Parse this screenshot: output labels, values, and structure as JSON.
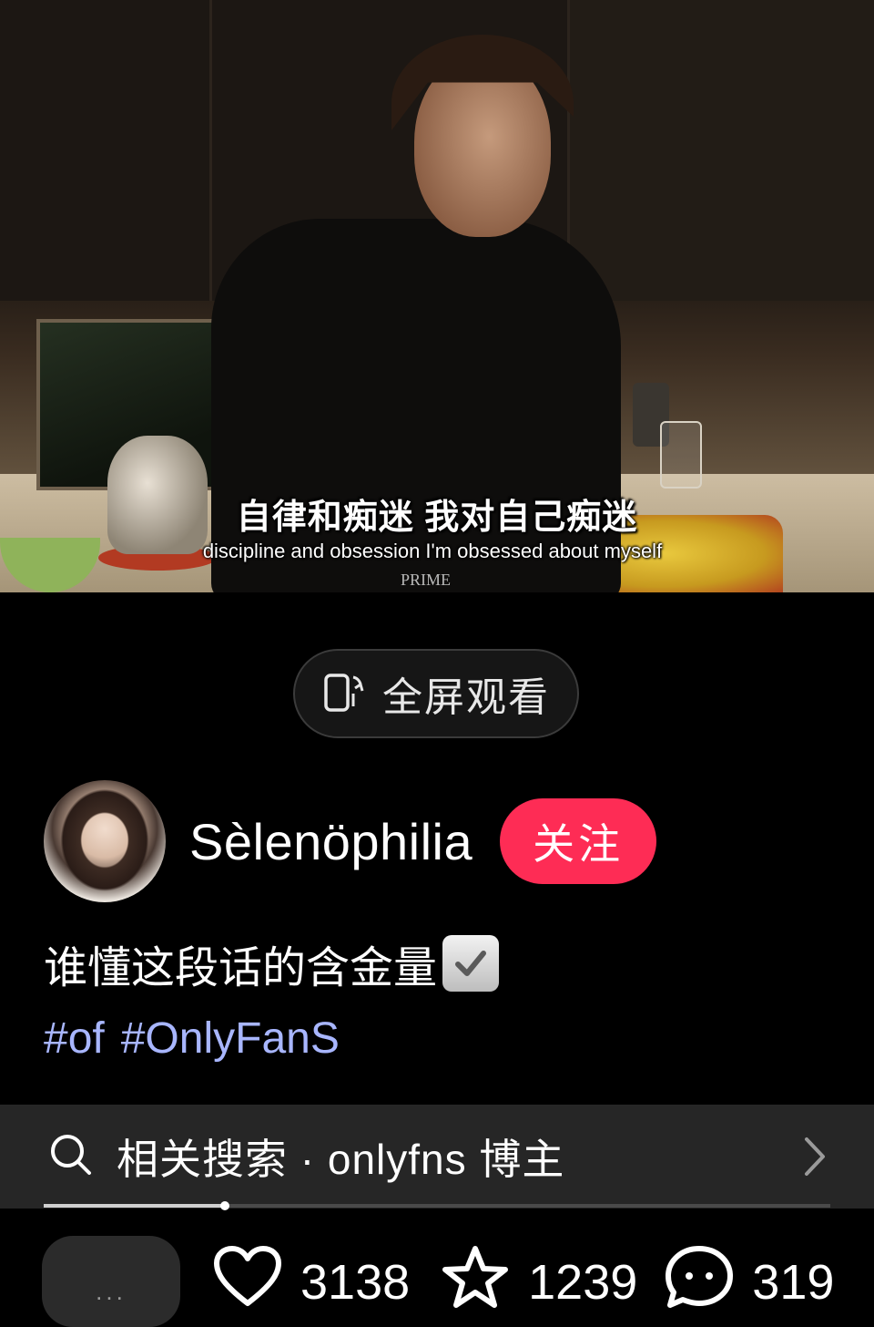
{
  "video": {
    "subtitle_cn": "自律和痴迷 我对自己痴迷",
    "subtitle_en": "discipline and obsession I'm obsessed about myself",
    "watermark": "PRIME"
  },
  "fullscreen_button": {
    "icon": "rotate-phone-icon",
    "label": "全屏观看"
  },
  "author": {
    "username": "Sèlenöphilia",
    "follow_label": "关注"
  },
  "post": {
    "caption": "谁懂这段话的含金量",
    "caption_emoji": "check-mark-button-icon",
    "hashtags": [
      "#of",
      "#OnlyFanS"
    ]
  },
  "related_search": {
    "label": "相关搜索 · onlyfns 博主"
  },
  "playback": {
    "progress_fraction": 0.23
  },
  "actions": {
    "comment_placeholder": "...",
    "likes": "3138",
    "favorites": "1239",
    "comments": "319"
  },
  "colors": {
    "follow_button": "#fe2c55",
    "hashtag": "#a8b6ff",
    "search_bar_bg": "#262626",
    "background": "#000000"
  }
}
